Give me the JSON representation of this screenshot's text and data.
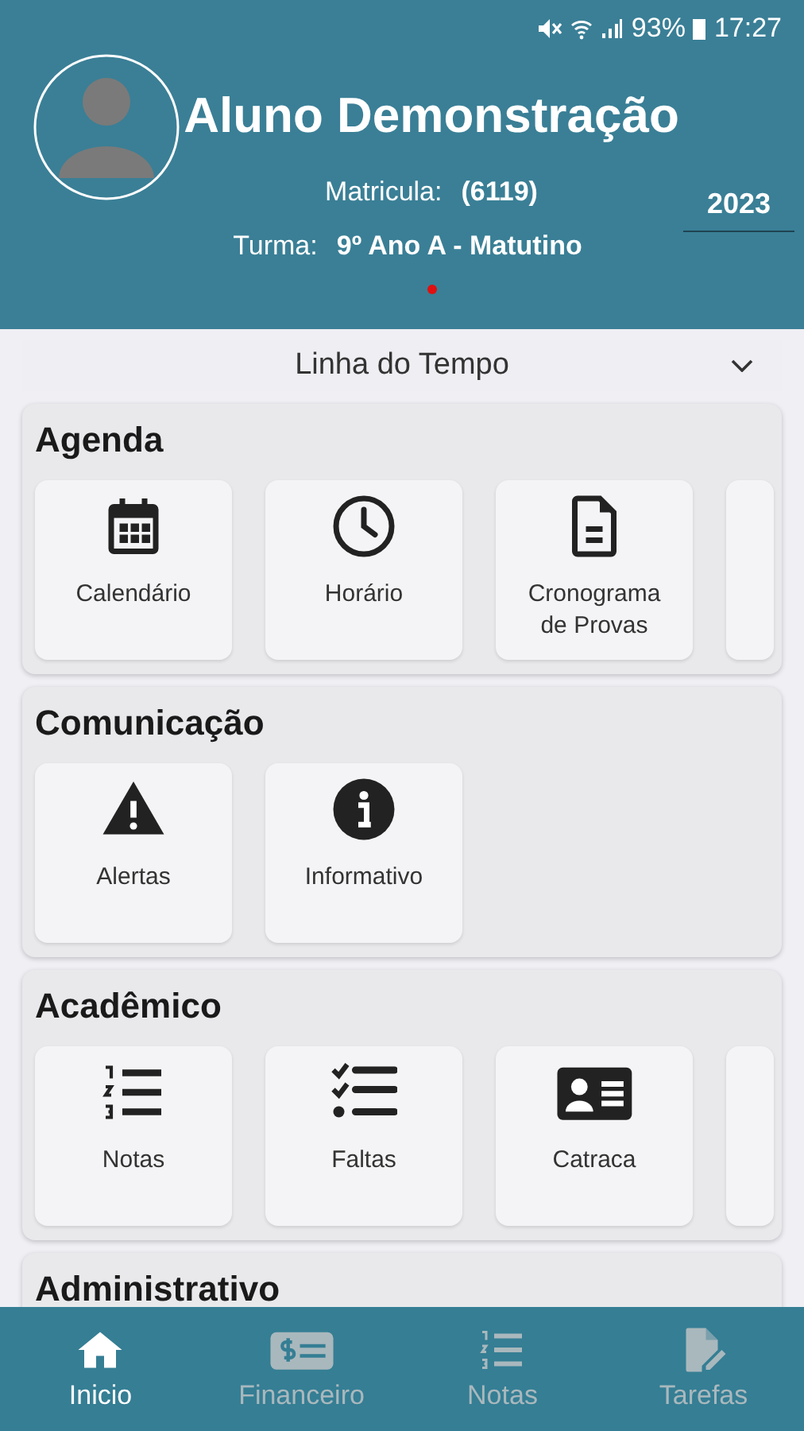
{
  "status_bar": {
    "battery": "93%",
    "time": "17:27"
  },
  "profile": {
    "name": "Aluno Demonstração",
    "enrollment_label": "Matricula:",
    "enrollment": "(6119)",
    "class_label": "Turma:",
    "class": "9º Ano A - Matutino",
    "year": "2023"
  },
  "timeline": {
    "label": "Linha do Tempo"
  },
  "sections": [
    {
      "title": "Agenda",
      "more": true,
      "tiles": [
        {
          "label": "Calendário",
          "kind": "calendar"
        },
        {
          "label": "Horário",
          "kind": "clock"
        },
        {
          "label": "Cronograma de Provas",
          "kind": "document"
        }
      ]
    },
    {
      "title": "Comunicação",
      "more": false,
      "tiles": [
        {
          "label": "Alertas",
          "kind": "warning"
        },
        {
          "label": "Informativo",
          "kind": "info"
        }
      ]
    },
    {
      "title": "Acadêmico",
      "more": true,
      "tiles": [
        {
          "label": "Notas",
          "kind": "numbered-list"
        },
        {
          "label": "Faltas",
          "kind": "checklist"
        },
        {
          "label": "Catraca",
          "kind": "id-card"
        }
      ]
    },
    {
      "title": "Administrativo"
    }
  ],
  "nav": [
    {
      "label": "Inicio",
      "kind": "home",
      "selected": true
    },
    {
      "label": "Financeiro",
      "kind": "money",
      "selected": false
    },
    {
      "label": "Notas",
      "kind": "numbered-list",
      "selected": false
    },
    {
      "label": "Tarefas",
      "kind": "edit-document",
      "selected": false
    }
  ]
}
